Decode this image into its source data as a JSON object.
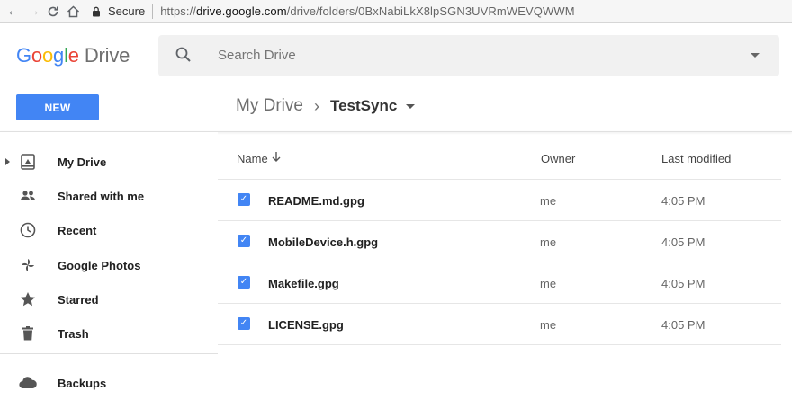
{
  "browser": {
    "secure_label": "Secure",
    "url_scheme": "https://",
    "url_host": "drive.google.com",
    "url_path": "/drive/folders/0BxNabiLkX8lpSGN3UVRmWEVQWWM"
  },
  "app": {
    "logo_letters": [
      "G",
      "o",
      "o",
      "g",
      "l",
      "e"
    ],
    "logo_product": "Drive"
  },
  "search": {
    "placeholder": "Search Drive"
  },
  "toolbar": {
    "new_label": "NEW"
  },
  "breadcrumb": {
    "root": "My Drive",
    "current": "TestSync"
  },
  "sidebar": {
    "items": [
      {
        "label": "My Drive",
        "icon": "my-drive-icon"
      },
      {
        "label": "Shared with me",
        "icon": "people-icon"
      },
      {
        "label": "Recent",
        "icon": "clock-icon"
      },
      {
        "label": "Google Photos",
        "icon": "pinwheel-icon"
      },
      {
        "label": "Starred",
        "icon": "star-icon"
      },
      {
        "label": "Trash",
        "icon": "trash-icon"
      },
      {
        "label": "Backups",
        "icon": "cloud-icon"
      }
    ]
  },
  "table": {
    "headers": {
      "name": "Name",
      "owner": "Owner",
      "modified": "Last modified"
    },
    "rows": [
      {
        "name": "README.md.gpg",
        "owner": "me",
        "modified": "4:05 PM"
      },
      {
        "name": "MobileDevice.h.gpg",
        "owner": "me",
        "modified": "4:05 PM"
      },
      {
        "name": "Makefile.gpg",
        "owner": "me",
        "modified": "4:05 PM"
      },
      {
        "name": "LICENSE.gpg",
        "owner": "me",
        "modified": "4:05 PM"
      }
    ]
  },
  "colors": {
    "accent": "#4285f4"
  }
}
